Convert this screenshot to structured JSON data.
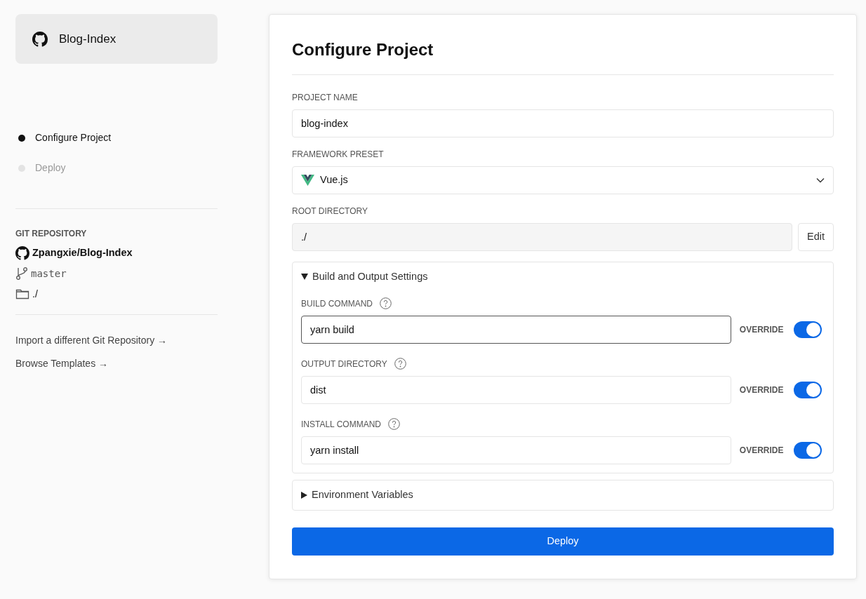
{
  "project": {
    "name": "Blog-Index"
  },
  "steps": [
    {
      "label": "Configure Project",
      "selected": true
    },
    {
      "label": "Deploy",
      "selected": false
    }
  ],
  "repository": {
    "heading": "GIT REPOSITORY",
    "name": "Zpangxie/Blog-Index",
    "branch": "master",
    "directory": "./"
  },
  "links": [
    "Import a different Git Repository →",
    "Browse Templates →"
  ],
  "form": {
    "title": "Configure Project",
    "fields": [
      {
        "kind": "text",
        "label": "PROJECT NAME",
        "value": "blog-index"
      },
      {
        "kind": "select",
        "label": "FRAMEWORK PRESET",
        "value": "Vue.js"
      },
      {
        "kind": "readonly",
        "label": "ROOT DIRECTORY",
        "value": "./",
        "button": "Edit"
      }
    ],
    "sections": [
      {
        "title": "Build and Output Settings",
        "expanded": true,
        "settings": [
          {
            "label": "BUILD COMMAND",
            "value": "yarn build",
            "focused": true,
            "toggle_label": "OVERRIDE",
            "on": true
          },
          {
            "label": "OUTPUT DIRECTORY",
            "value": "dist",
            "focused": false,
            "toggle_label": "OVERRIDE",
            "on": true
          },
          {
            "label": "INSTALL COMMAND",
            "value": "yarn install",
            "focused": false,
            "toggle_label": "OVERRIDE",
            "on": true
          }
        ]
      },
      {
        "title": "Environment Variables",
        "expanded": false
      }
    ],
    "submit": "Deploy"
  }
}
